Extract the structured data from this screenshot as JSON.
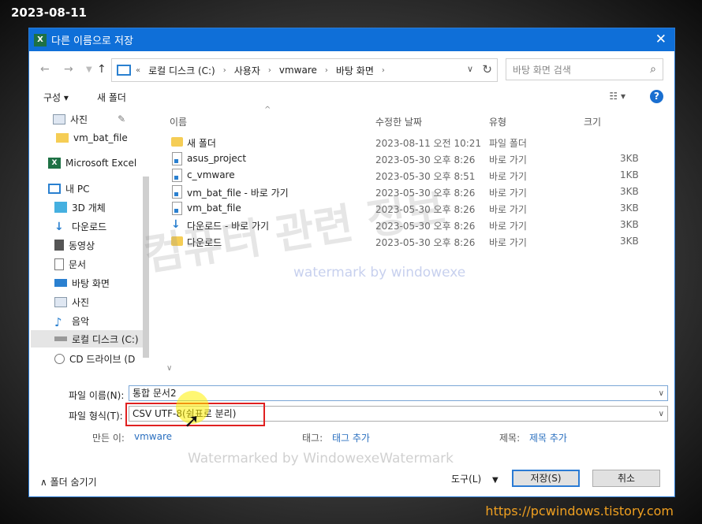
{
  "overlay": {
    "date": "2023-08-11",
    "site": "https://pcwindows.tistory.com",
    "watermark_ko": "컴퓨터 관련 정보",
    "watermark_en": "watermark by windowexe",
    "watermark_bottom": "Watermarked by WindowexeWatermark"
  },
  "dialog": {
    "title": "다른 이름으로 저장",
    "address": {
      "prefix": "«",
      "crumbs": [
        "로컬 디스크 (C:)",
        "사용자",
        "vmware",
        "바탕 화면"
      ]
    },
    "search_placeholder": "바탕 화면 검색",
    "toolbar": {
      "organize": "구성",
      "new_folder": "새 폴더"
    },
    "nav_items": [
      {
        "label": "사진",
        "icon": "pictures-icon"
      },
      {
        "label": "vm_bat_file",
        "icon": "folder-icon"
      },
      {
        "label": "Microsoft Excel",
        "icon": "excel-icon"
      },
      {
        "label": "내 PC",
        "icon": "pc-icon"
      },
      {
        "label": "3D 개체",
        "icon": "cube-icon"
      },
      {
        "label": "다운로드",
        "icon": "download-icon"
      },
      {
        "label": "동영상",
        "icon": "video-icon"
      },
      {
        "label": "문서",
        "icon": "document-icon"
      },
      {
        "label": "바탕 화면",
        "icon": "desktop-icon"
      },
      {
        "label": "사진",
        "icon": "pictures-icon"
      },
      {
        "label": "음악",
        "icon": "music-icon"
      },
      {
        "label": "로컬 디스크 (C:)",
        "icon": "drive-icon"
      },
      {
        "label": "CD 드라이브 (D",
        "icon": "cd-drive-icon"
      }
    ],
    "columns": {
      "name": "이름",
      "date": "수정한 날짜",
      "type": "유형",
      "size": "크기"
    },
    "files": [
      {
        "name": "새 폴더",
        "date": "2023-08-11 오전 10:21",
        "type": "파일 폴더",
        "size": "",
        "kind": "folder"
      },
      {
        "name": "asus_project",
        "date": "2023-05-30 오후 8:26",
        "type": "바로 가기",
        "size": "3KB",
        "kind": "shortcut"
      },
      {
        "name": "c_vmware",
        "date": "2023-05-30 오후 8:51",
        "type": "바로 가기",
        "size": "1KB",
        "kind": "shortcut"
      },
      {
        "name": "vm_bat_file - 바로 가기",
        "date": "2023-05-30 오후 8:26",
        "type": "바로 가기",
        "size": "3KB",
        "kind": "shortcut"
      },
      {
        "name": "vm_bat_file",
        "date": "2023-05-30 오후 8:26",
        "type": "바로 가기",
        "size": "3KB",
        "kind": "shortcut"
      },
      {
        "name": "다운로드 - 바로 가기",
        "date": "2023-05-30 오후 8:26",
        "type": "바로 가기",
        "size": "3KB",
        "kind": "download"
      },
      {
        "name": "다운로드",
        "date": "2023-05-30 오후 8:26",
        "type": "바로 가기",
        "size": "3KB",
        "kind": "shortcut"
      }
    ],
    "filename_label": "파일 이름(N):",
    "filename_value": "통합 문서2",
    "filetype_label": "파일 형식(T):",
    "filetype_value": "CSV UTF-8(쉼표로 분리)",
    "authors_label": "만든 이:",
    "authors_value": "vmware",
    "tags_label": "태그:",
    "tags_value": "태그 추가",
    "title_label": "제목:",
    "title_value": "제목 추가",
    "hide_folders": "폴더 숨기기",
    "tools": "도구(L)",
    "save": "저장(S)",
    "cancel": "취소"
  }
}
